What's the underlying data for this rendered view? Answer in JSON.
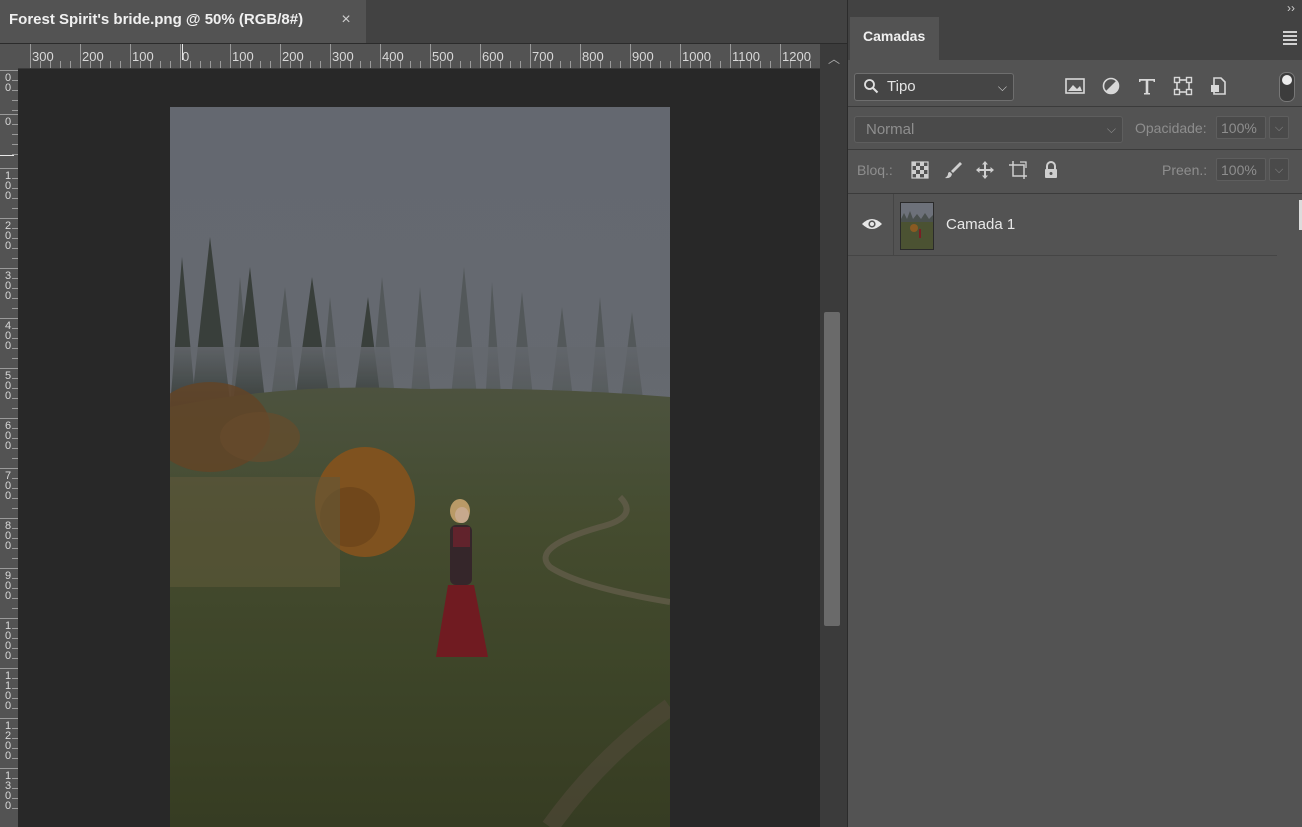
{
  "document": {
    "tab_title": "Forest Spirit's bride.png @ 50% (RGB/8#)",
    "close_icon": "close-icon",
    "h_ruler_labels": [
      "300",
      "200",
      "100",
      "0",
      "100",
      "200",
      "300",
      "400",
      "500",
      "600",
      "700",
      "800",
      "900",
      "1000",
      "1100",
      "1200"
    ],
    "v_ruler_labels": [
      "0\n0",
      "0",
      "1\n0\n0",
      "2\n0\n0",
      "3\n0\n0",
      "4\n0\n0",
      "5\n0\n0",
      "6\n0\n0",
      "7\n0\n0",
      "8\n0\n0",
      "9\n0\n0",
      "1\n0\n0\n0",
      "1\n1\n0\n0",
      "1\n2\n0\n0",
      "1\n3\n0\n0"
    ]
  },
  "panel": {
    "collapse_icon": "double-chevron-right-icon",
    "tab_label": "Camadas",
    "menu_icon": "hamburger-menu-icon",
    "filter": {
      "label": "Tipo",
      "icons": [
        "image-filter-icon",
        "adjustment-filter-icon",
        "type-filter-icon",
        "shape-filter-icon",
        "smart-object-filter-icon"
      ]
    },
    "blend_mode": "Normal",
    "opacity": {
      "label": "Opacidade:",
      "value": "100%"
    },
    "lock": {
      "label": "Bloq.:",
      "icons": [
        "lock-transparency-icon",
        "lock-brush-icon",
        "lock-position-icon",
        "lock-artboard-icon",
        "lock-all-icon"
      ]
    },
    "fill": {
      "label": "Preen.:",
      "value": "100%"
    },
    "layers": [
      {
        "name": "Camada 1",
        "visible": true
      }
    ]
  },
  "colors": {
    "app_bg": "#282828",
    "panel_bg": "#535353",
    "tab_bar": "#424242"
  }
}
